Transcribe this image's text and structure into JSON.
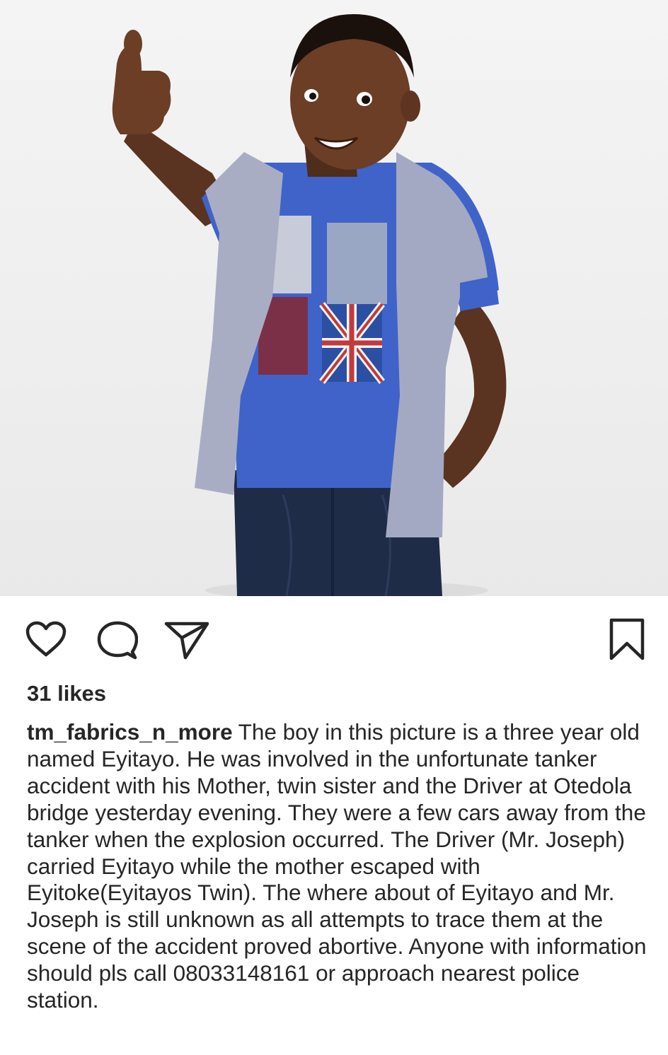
{
  "post": {
    "photo_alt": "Smiling boy in blue shirt giving a thumbs up",
    "likes": "31 likes",
    "username": "tm_fabrics_n_more",
    "caption": "The boy in this picture is a three year old named Eyitayo. He was involved in the unfortunate tanker accident with his Mother, twin sister and the Driver at Otedola bridge yesterday evening. They were a few cars away from the tanker when the explosion occurred. The Driver (Mr. Joseph) carried Eyitayo while the mother escaped with Eyitoke(Eyitayos Twin). The where about of Eyitayo and Mr. Joseph is still unknown as all attempts to trace them at the scene of the accident proved abortive. Anyone with information should pls call 08033148161 or approach nearest police station."
  },
  "actions": {
    "like_icon": "heart-icon",
    "comment_icon": "comment-icon",
    "share_icon": "paper-plane-icon",
    "save_icon": "bookmark-icon"
  },
  "colors": {
    "text": "#262626",
    "icon_stroke": "#262626",
    "background": "#ffffff"
  }
}
